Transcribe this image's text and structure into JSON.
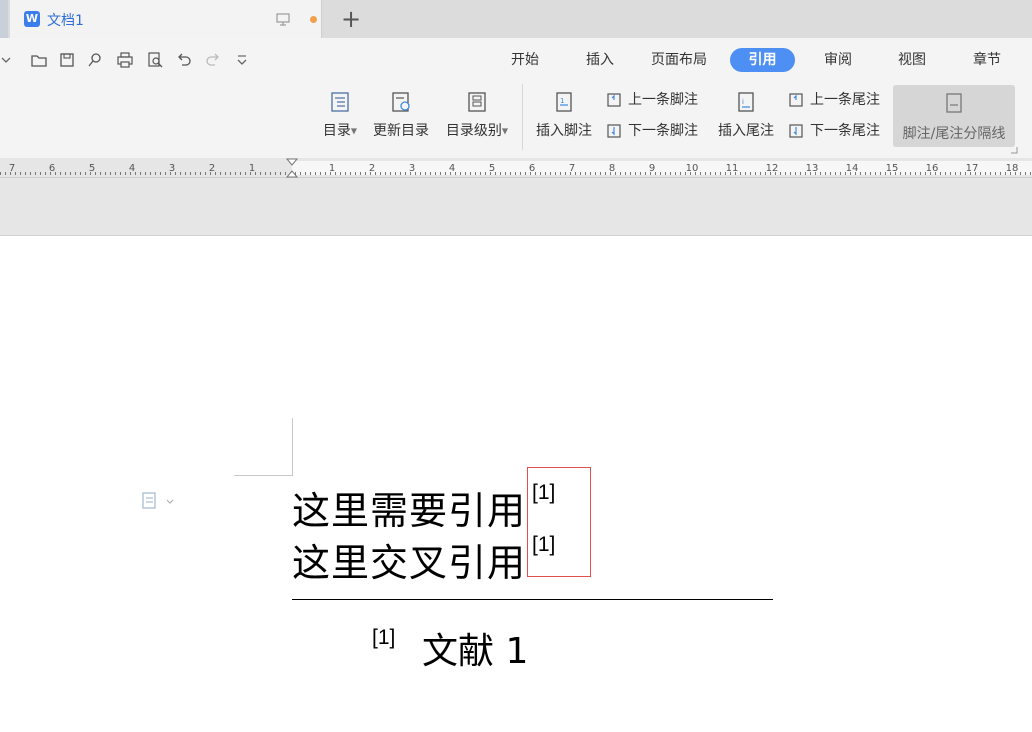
{
  "tab": {
    "title": "文档1"
  },
  "menu": [
    "开始",
    "插入",
    "页面布局",
    "引用",
    "审阅",
    "视图",
    "章节"
  ],
  "menu_active": "引用",
  "ribbon": {
    "toc": "目录",
    "update_toc": "更新目录",
    "toc_level": "目录级别",
    "insert_footnote": "插入脚注",
    "prev_footnote": "上一条脚注",
    "next_footnote": "下一条脚注",
    "insert_endnote": "插入尾注",
    "prev_endnote": "上一条尾注",
    "next_endnote": "下一条尾注",
    "separator_line": "脚注/尾注分隔线"
  },
  "ruler": {
    "left_numbers": [
      "7",
      "6",
      "5",
      "4",
      "3",
      "2",
      "1"
    ],
    "right_numbers": [
      "1",
      "2",
      "3",
      "4",
      "5",
      "6",
      "7",
      "8",
      "9",
      "10",
      "11",
      "12",
      "13",
      "14",
      "15",
      "16",
      "17",
      "18"
    ]
  },
  "document": {
    "line1": "这里需要引用",
    "line1_ref": "[1]",
    "line2": "这里交叉引用",
    "line2_ref": "[1]",
    "footnote_ref": "[1]",
    "footnote_text": "文献 1"
  },
  "colors": {
    "accent": "#4d8ff2",
    "tab_text": "#2f6ed6",
    "highlight_box": "#e05050",
    "unsaved_dot": "#f0a04b"
  }
}
